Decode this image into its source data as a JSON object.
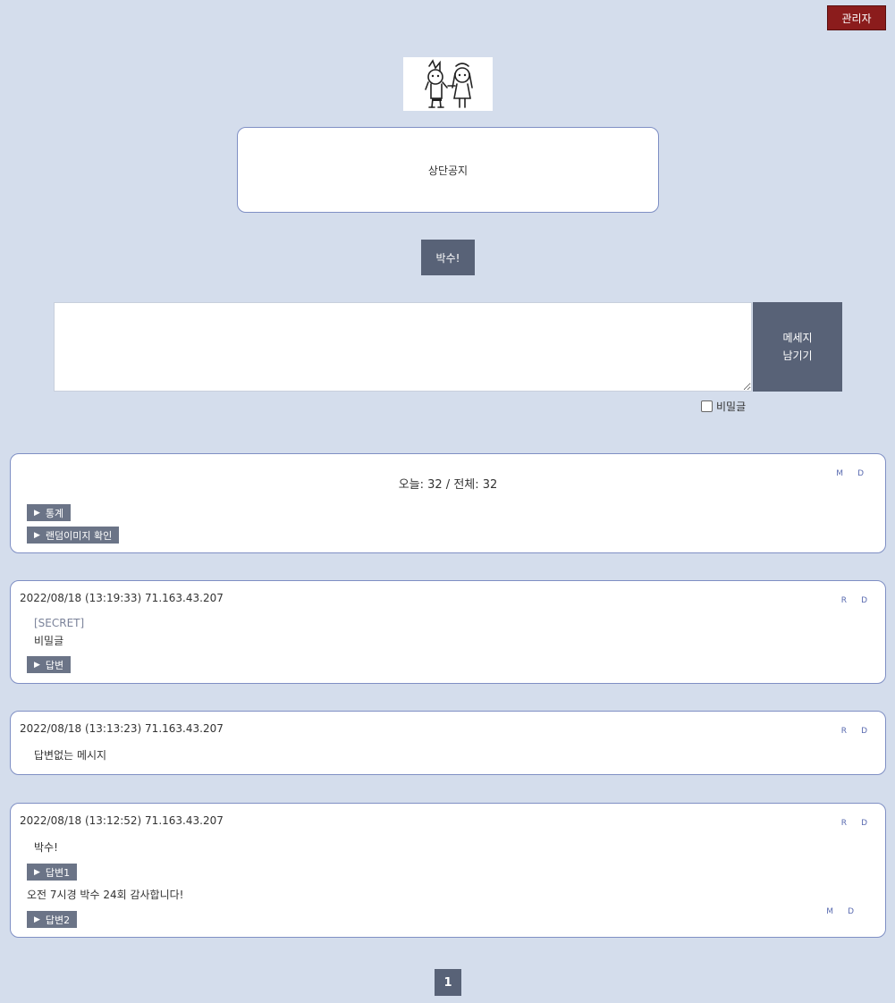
{
  "header": {
    "admin_label": "관리자"
  },
  "logo": {
    "icon": "character-doodle-logo"
  },
  "notice": {
    "text": "상단공지"
  },
  "clap": {
    "label": "박수!"
  },
  "form": {
    "message_value": "",
    "send_label": "메세지\n남기기",
    "secret_label": "비밀글",
    "secret_checked": false
  },
  "stats": {
    "counter": "오늘: 32 / 전체: 32",
    "controls": [
      "M",
      "D"
    ],
    "buttons": [
      "통계",
      "랜덤이미지 확인"
    ]
  },
  "posts": [
    {
      "meta": "2022/08/18 (13:19:33) 71.163.43.207",
      "controls": [
        "R",
        "D"
      ],
      "secret_tag": "[SECRET]",
      "text": "비밀글",
      "reply_button": "답변"
    },
    {
      "meta": "2022/08/18 (13:13:23) 71.163.43.207",
      "controls": [
        "R",
        "D"
      ],
      "text": "답변없는 메시지"
    },
    {
      "meta": "2022/08/18 (13:12:52) 71.163.43.207",
      "controls": [
        "R",
        "D"
      ],
      "text": "박수!",
      "reply1_button": "답변1",
      "reply_text": "오전 7시경 박수 24회 감사합니다!",
      "reply_controls": [
        "M",
        "D"
      ],
      "reply2_button": "답변2"
    }
  ],
  "pagination": {
    "current": "1"
  },
  "colors": {
    "background": "#d4ddec",
    "accent": "#586277",
    "admin": "#8b1c1c",
    "border": "#7f8fc4"
  }
}
